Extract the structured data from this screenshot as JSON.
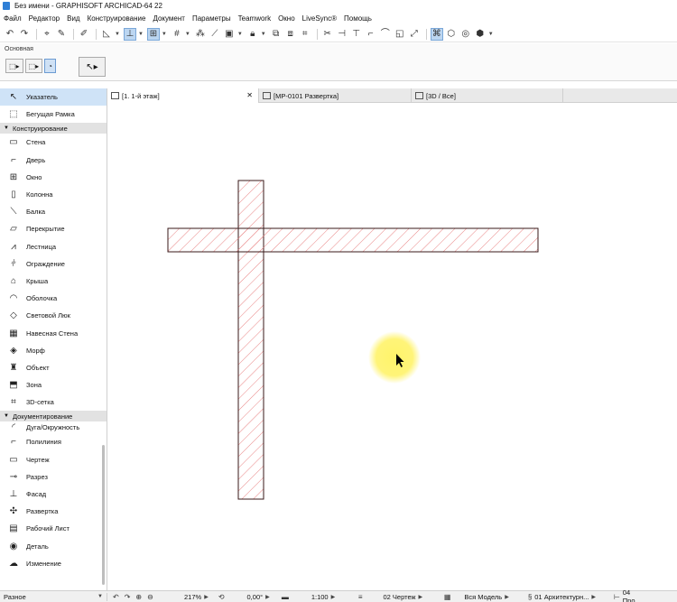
{
  "window": {
    "title": "Без имени - GRAPHISOFT ARCHICAD-64 22"
  },
  "menu": [
    "Файл",
    "Редактор",
    "Вид",
    "Конструирование",
    "Документ",
    "Параметры",
    "Teamwork",
    "Окно",
    "LiveSync®",
    "Помощь"
  ],
  "infobox": {
    "tab_label": "Основная"
  },
  "toolbox": {
    "top_items": [
      {
        "label": "Указатель",
        "icon": "pointer-icon",
        "selected": true
      },
      {
        "label": "Бегущая Рамка",
        "icon": "marquee-icon",
        "selected": false
      }
    ],
    "design_header": "Конструирование",
    "design_items": [
      {
        "label": "Стена",
        "icon": "wall-icon"
      },
      {
        "label": "Дверь",
        "icon": "door-icon"
      },
      {
        "label": "Окно",
        "icon": "window-icon"
      },
      {
        "label": "Колонна",
        "icon": "column-icon"
      },
      {
        "label": "Балка",
        "icon": "beam-icon"
      },
      {
        "label": "Перекрытие",
        "icon": "slab-icon"
      },
      {
        "label": "Лестница",
        "icon": "stair-icon"
      },
      {
        "label": "Ограждение",
        "icon": "railing-icon"
      },
      {
        "label": "Крыша",
        "icon": "roof-icon"
      },
      {
        "label": "Оболочка",
        "icon": "shell-icon"
      },
      {
        "label": "Световой Люк",
        "icon": "skylight-icon"
      },
      {
        "label": "Навесная Стена",
        "icon": "curtain-wall-icon"
      },
      {
        "label": "Морф",
        "icon": "morph-icon"
      },
      {
        "label": "Объект",
        "icon": "object-icon"
      },
      {
        "label": "Зона",
        "icon": "zone-icon"
      },
      {
        "label": "3D-сетка",
        "icon": "mesh-icon"
      }
    ],
    "doc_header": "Документирование",
    "doc_items": [
      {
        "label": "Дуга/Окружность",
        "icon": "arc-icon"
      },
      {
        "label": "Полилиния",
        "icon": "polyline-icon"
      },
      {
        "label": "Чертеж",
        "icon": "drawing-icon"
      },
      {
        "label": "Разрез",
        "icon": "section-icon"
      },
      {
        "label": "Фасад",
        "icon": "elevation-icon"
      },
      {
        "label": "Развертка",
        "icon": "interior-elevation-icon"
      },
      {
        "label": "Рабочий Лист",
        "icon": "worksheet-icon"
      },
      {
        "label": "Деталь",
        "icon": "detail-icon"
      },
      {
        "label": "Изменение",
        "icon": "change-icon"
      }
    ],
    "more_label": "Разное"
  },
  "tabs": [
    {
      "label": "[1. 1-й этаж]",
      "active": true
    },
    {
      "label": "[МР-0101 Развертка]",
      "active": false
    },
    {
      "label": "[3D / Все]",
      "active": false
    }
  ],
  "status": {
    "zoom": "217%",
    "angle": "0,00°",
    "scale": "1:100",
    "pen_set": "02 Чертеж",
    "model_view": "Вся Модель",
    "layer_combo": "01 Архитектурн...",
    "dimension": "04 Про"
  },
  "colors": {
    "hatch": "#e98585",
    "wall_outline": "#3a1a1a",
    "cursor_glow": "#fff36a",
    "selection": "#cfe3f7"
  }
}
